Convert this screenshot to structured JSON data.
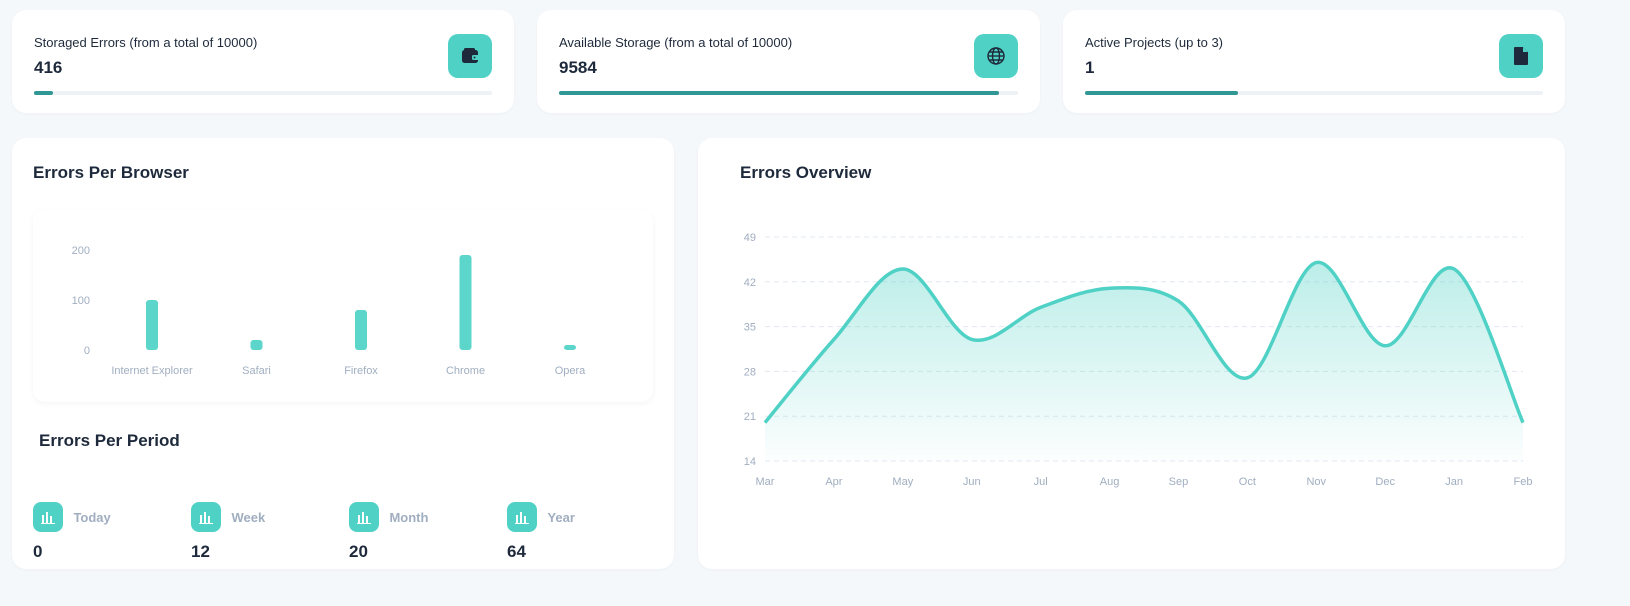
{
  "stats": [
    {
      "label": "Storaged Errors (from a total of 10000)",
      "value": "416",
      "progress": 0.0416,
      "icon": "wallet-icon"
    },
    {
      "label": "Available Storage (from a total of 10000)",
      "value": "9584",
      "progress": 0.9584,
      "icon": "globe-icon"
    },
    {
      "label": "Active Projects (up to 3)",
      "value": "1",
      "progress": 0.3333,
      "icon": "file-icon"
    }
  ],
  "browser_panel": {
    "title": "Errors Per Browser"
  },
  "period_panel": {
    "title": "Errors Per Period",
    "items": [
      {
        "label": "Today",
        "value": "0"
      },
      {
        "label": "Week",
        "value": "12"
      },
      {
        "label": "Month",
        "value": "20"
      },
      {
        "label": "Year",
        "value": "64"
      }
    ]
  },
  "overview_panel": {
    "title": "Errors Overview"
  },
  "colors": {
    "accent": "#4fd1c5",
    "accent_dark": "#319795",
    "muted": "#a0aec0"
  },
  "chart_data": [
    {
      "type": "bar",
      "title": "Errors Per Browser",
      "categories": [
        "Internet Explorer",
        "Safari",
        "Firefox",
        "Chrome",
        "Opera"
      ],
      "values": [
        100,
        20,
        80,
        190,
        5
      ],
      "ylim": [
        0,
        200
      ],
      "yticks": [
        0,
        100,
        200
      ],
      "grid": false
    },
    {
      "type": "area",
      "title": "Errors Overview",
      "categories": [
        "Mar",
        "Apr",
        "May",
        "Jun",
        "Jul",
        "Aug",
        "Sep",
        "Oct",
        "Nov",
        "Dec",
        "Jan",
        "Feb"
      ],
      "values": [
        20,
        33,
        44,
        33,
        38,
        41,
        39,
        27,
        45,
        32,
        44,
        20
      ],
      "ylim": [
        14,
        49
      ],
      "yticks": [
        14,
        21,
        28,
        35,
        42,
        49
      ],
      "grid": true
    }
  ]
}
